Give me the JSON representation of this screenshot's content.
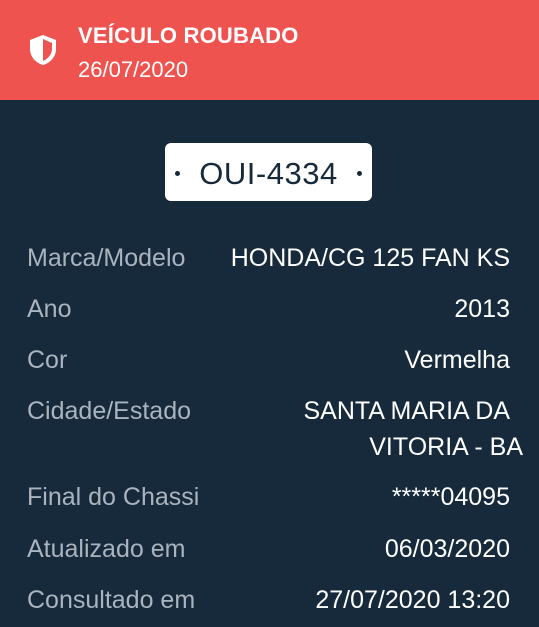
{
  "banner": {
    "icon": "shield-icon",
    "color": "#ef5350",
    "title": "VEÍCULO ROUBADO",
    "date": "26/07/2020"
  },
  "plate": "OUI-4334",
  "fields": {
    "marca_modelo": {
      "label": "Marca/Modelo",
      "value": "HONDA/CG 125 FAN KS"
    },
    "ano": {
      "label": "Ano",
      "value": "2013"
    },
    "cor": {
      "label": "Cor",
      "value": "Vermelha"
    },
    "cidade_estado": {
      "label": "Cidade/Estado",
      "value_line1": "SANTA MARIA DA",
      "value_line2": "VITORIA - BA"
    },
    "final_chassi": {
      "label": "Final do Chassi",
      "value": "*****04095"
    },
    "atualizado": {
      "label": "Atualizado em",
      "value": "06/03/2020"
    },
    "consultado": {
      "label": "Consultado em",
      "value": "27/07/2020 13:20"
    }
  },
  "colors": {
    "background": "#172a3b",
    "label": "#a9b4bf",
    "value": "#ffffff"
  }
}
